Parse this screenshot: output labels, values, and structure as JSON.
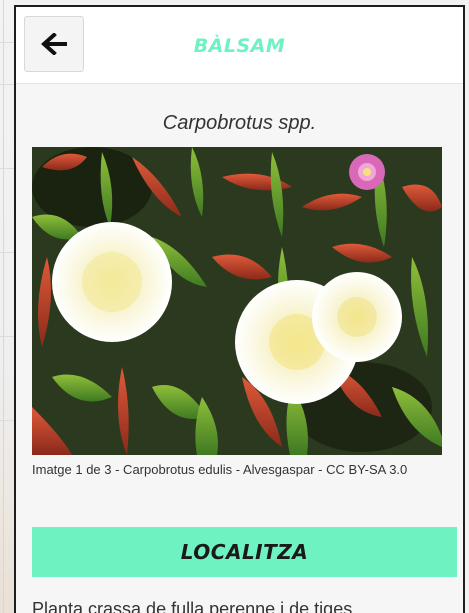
{
  "header": {
    "title": "BÀLSAM",
    "back_icon": "arrow-left-icon"
  },
  "species": {
    "name": "Carpobrotus spp."
  },
  "photo": {
    "caption": "Imatge 1 de 3 - Carpobrotus edulis - Alvesgaspar - CC BY-SA 3.0"
  },
  "section": {
    "button_label": "LOCALITZA"
  },
  "description": {
    "text": "Planta crassa de fulla perenne i de tiges"
  },
  "colors": {
    "accent": "#6ff2c2"
  }
}
